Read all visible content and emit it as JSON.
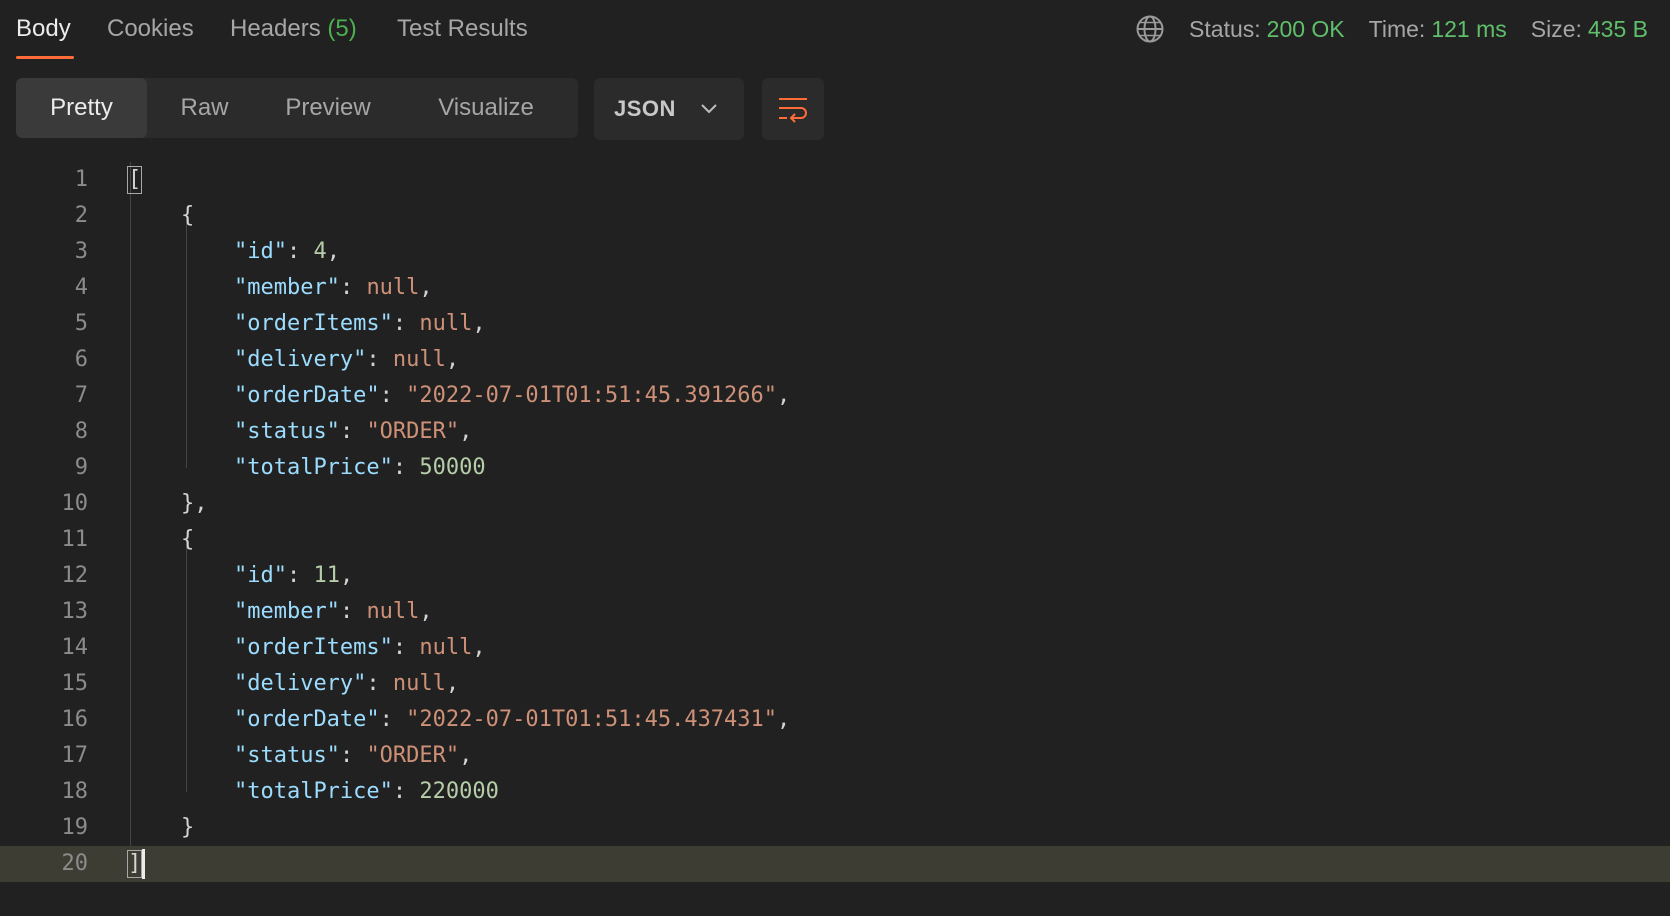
{
  "tabs": {
    "body": "Body",
    "cookies": "Cookies",
    "headers": "Headers",
    "headers_count": "(5)",
    "test_results": "Test Results"
  },
  "response_meta": {
    "status_label": "Status:",
    "status_value": "200 OK",
    "time_label": "Time:",
    "time_value": "121 ms",
    "size_label": "Size:",
    "size_value": "435 B"
  },
  "view_modes": {
    "pretty": "Pretty",
    "raw": "Raw",
    "preview": "Preview",
    "visualize": "Visualize",
    "active": "Pretty"
  },
  "format_select": {
    "value": "JSON"
  },
  "icons": {
    "globe": "globe-icon",
    "chevron": "chevron-down-icon",
    "wrap": "wrap-lines-icon"
  },
  "colors": {
    "accent": "#ff6c37",
    "status_ok": "#5fbf6a",
    "json_key": "#9cdcfe",
    "json_number": "#b5cea8",
    "json_string": "#ce9178"
  },
  "editor": {
    "current_line": 20,
    "lines": [
      {
        "n": "1",
        "tokens": [
          {
            "t": "bracket",
            "v": "["
          }
        ]
      },
      {
        "n": "2",
        "tokens": [
          {
            "t": "p",
            "v": "    {"
          }
        ]
      },
      {
        "n": "3",
        "tokens": [
          {
            "t": "p",
            "v": "        "
          },
          {
            "t": "k",
            "v": "\"id\""
          },
          {
            "t": "p",
            "v": ": "
          },
          {
            "t": "n",
            "v": "4"
          },
          {
            "t": "p",
            "v": ","
          }
        ]
      },
      {
        "n": "4",
        "tokens": [
          {
            "t": "p",
            "v": "        "
          },
          {
            "t": "k",
            "v": "\"member\""
          },
          {
            "t": "p",
            "v": ": "
          },
          {
            "t": "nl",
            "v": "null"
          },
          {
            "t": "p",
            "v": ","
          }
        ]
      },
      {
        "n": "5",
        "tokens": [
          {
            "t": "p",
            "v": "        "
          },
          {
            "t": "k",
            "v": "\"orderItems\""
          },
          {
            "t": "p",
            "v": ": "
          },
          {
            "t": "nl",
            "v": "null"
          },
          {
            "t": "p",
            "v": ","
          }
        ]
      },
      {
        "n": "6",
        "tokens": [
          {
            "t": "p",
            "v": "        "
          },
          {
            "t": "k",
            "v": "\"delivery\""
          },
          {
            "t": "p",
            "v": ": "
          },
          {
            "t": "nl",
            "v": "null"
          },
          {
            "t": "p",
            "v": ","
          }
        ]
      },
      {
        "n": "7",
        "tokens": [
          {
            "t": "p",
            "v": "        "
          },
          {
            "t": "k",
            "v": "\"orderDate\""
          },
          {
            "t": "p",
            "v": ": "
          },
          {
            "t": "s",
            "v": "\"2022-07-01T01:51:45.391266\""
          },
          {
            "t": "p",
            "v": ","
          }
        ]
      },
      {
        "n": "8",
        "tokens": [
          {
            "t": "p",
            "v": "        "
          },
          {
            "t": "k",
            "v": "\"status\""
          },
          {
            "t": "p",
            "v": ": "
          },
          {
            "t": "s",
            "v": "\"ORDER\""
          },
          {
            "t": "p",
            "v": ","
          }
        ]
      },
      {
        "n": "9",
        "tokens": [
          {
            "t": "p",
            "v": "        "
          },
          {
            "t": "k",
            "v": "\"totalPrice\""
          },
          {
            "t": "p",
            "v": ": "
          },
          {
            "t": "n",
            "v": "50000"
          }
        ]
      },
      {
        "n": "10",
        "tokens": [
          {
            "t": "p",
            "v": "    },"
          }
        ]
      },
      {
        "n": "11",
        "tokens": [
          {
            "t": "p",
            "v": "    {"
          }
        ]
      },
      {
        "n": "12",
        "tokens": [
          {
            "t": "p",
            "v": "        "
          },
          {
            "t": "k",
            "v": "\"id\""
          },
          {
            "t": "p",
            "v": ": "
          },
          {
            "t": "n",
            "v": "11"
          },
          {
            "t": "p",
            "v": ","
          }
        ]
      },
      {
        "n": "13",
        "tokens": [
          {
            "t": "p",
            "v": "        "
          },
          {
            "t": "k",
            "v": "\"member\""
          },
          {
            "t": "p",
            "v": ": "
          },
          {
            "t": "nl",
            "v": "null"
          },
          {
            "t": "p",
            "v": ","
          }
        ]
      },
      {
        "n": "14",
        "tokens": [
          {
            "t": "p",
            "v": "        "
          },
          {
            "t": "k",
            "v": "\"orderItems\""
          },
          {
            "t": "p",
            "v": ": "
          },
          {
            "t": "nl",
            "v": "null"
          },
          {
            "t": "p",
            "v": ","
          }
        ]
      },
      {
        "n": "15",
        "tokens": [
          {
            "t": "p",
            "v": "        "
          },
          {
            "t": "k",
            "v": "\"delivery\""
          },
          {
            "t": "p",
            "v": ": "
          },
          {
            "t": "nl",
            "v": "null"
          },
          {
            "t": "p",
            "v": ","
          }
        ]
      },
      {
        "n": "16",
        "tokens": [
          {
            "t": "p",
            "v": "        "
          },
          {
            "t": "k",
            "v": "\"orderDate\""
          },
          {
            "t": "p",
            "v": ": "
          },
          {
            "t": "s",
            "v": "\"2022-07-01T01:51:45.437431\""
          },
          {
            "t": "p",
            "v": ","
          }
        ]
      },
      {
        "n": "17",
        "tokens": [
          {
            "t": "p",
            "v": "        "
          },
          {
            "t": "k",
            "v": "\"status\""
          },
          {
            "t": "p",
            "v": ": "
          },
          {
            "t": "s",
            "v": "\"ORDER\""
          },
          {
            "t": "p",
            "v": ","
          }
        ]
      },
      {
        "n": "18",
        "tokens": [
          {
            "t": "p",
            "v": "        "
          },
          {
            "t": "k",
            "v": "\"totalPrice\""
          },
          {
            "t": "p",
            "v": ": "
          },
          {
            "t": "n",
            "v": "220000"
          }
        ]
      },
      {
        "n": "19",
        "tokens": [
          {
            "t": "p",
            "v": "    }"
          }
        ]
      },
      {
        "n": "20",
        "tokens": [
          {
            "t": "bracket",
            "v": "]"
          },
          {
            "t": "cursor",
            "v": ""
          }
        ]
      }
    ]
  }
}
